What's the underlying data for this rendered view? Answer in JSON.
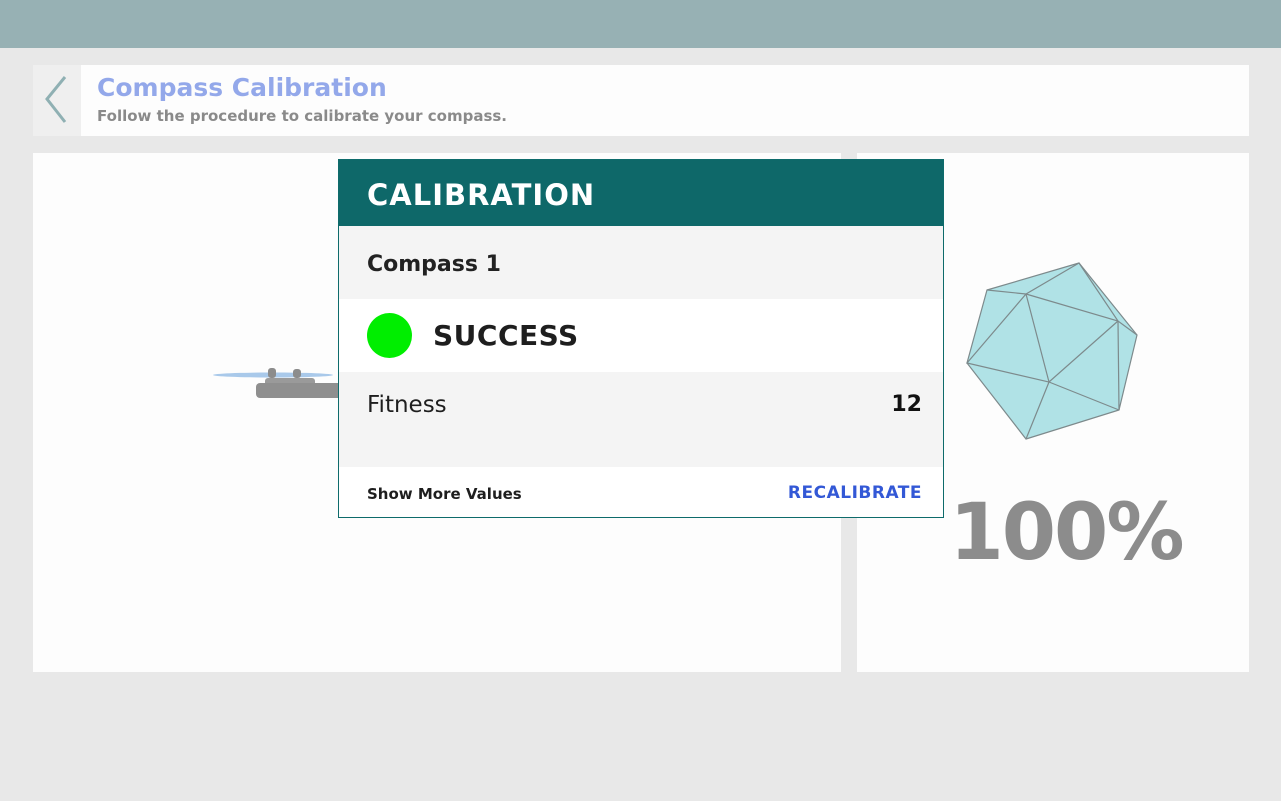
{
  "header": {
    "title": "Compass Calibration",
    "subtitle": "Follow the procedure to calibrate your compass.",
    "back_icon": "chevron-left-icon"
  },
  "progress": {
    "label": "100%",
    "value": 100
  },
  "dialog": {
    "title": "CALIBRATION",
    "compass_name": "Compass 1",
    "status": "SUCCESS",
    "status_color": "#00ee00",
    "fitness_label": "Fitness",
    "fitness_value": "12",
    "show_more_label": "Show More Values",
    "recalibrate_label": "RECALIBRATE"
  },
  "colors": {
    "topbar": "#97b1b4",
    "title": "#93a8ea",
    "dialog_header": "#0e6869",
    "accent_link": "#3358d6",
    "polyhedron_fill": "#b0e2e6"
  }
}
